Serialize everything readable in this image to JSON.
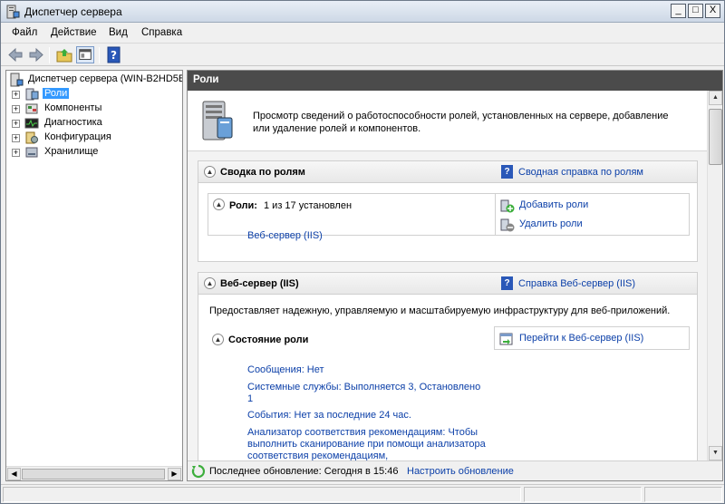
{
  "window": {
    "title": "Диспетчер сервера",
    "buttons": {
      "minimize": "_",
      "maximize": "□",
      "close": "X"
    }
  },
  "menu": [
    "Файл",
    "Действие",
    "Вид",
    "Справка"
  ],
  "toolbar": {
    "icons": [
      "back-arrow-icon",
      "forward-arrow-icon",
      "up-folder-icon",
      "show-hide-console-tree-icon",
      "help-icon"
    ]
  },
  "tree": {
    "root": "Диспетчер сервера (WIN-B2HD5B",
    "items": [
      {
        "label": "Роли",
        "icon": "roles-icon",
        "selected": true
      },
      {
        "label": "Компоненты",
        "icon": "features-icon",
        "selected": false
      },
      {
        "label": "Диагностика",
        "icon": "diagnostics-icon",
        "selected": false
      },
      {
        "label": "Конфигурация",
        "icon": "configuration-icon",
        "selected": false
      },
      {
        "label": "Хранилище",
        "icon": "storage-icon",
        "selected": false
      }
    ]
  },
  "main": {
    "header": "Роли",
    "intro": "Просмотр сведений о работоспособности ролей, установленных на сервере, добавление или удаление ролей и компонентов.",
    "summary": {
      "title": "Сводка по ролям",
      "help_link": "Сводная справка по ролям",
      "roles_label": "Роли:",
      "roles_count": "1 из 17 установлен",
      "role_link": "Веб-сервер (IIS)",
      "add_roles": "Добавить роли",
      "remove_roles": "Удалить роли"
    },
    "webserver": {
      "title": "Веб-сервер (IIS)",
      "help_link": "Справка Веб-сервер (IIS)",
      "description": "Предоставляет надежную, управляемую и масштабируемую инфраструктуру для веб-приложений.",
      "status_title": "Состояние роли",
      "goto_link": "Перейти к Веб-сервер (IIS)",
      "messages": "Сообщения: Нет",
      "services": "Системные службы: Выполняется 3, Остановлено 1",
      "events": "События: Нет за последние 24 час.",
      "bpa": "Анализатор соответствия рекомендациям: Чтобы выполнить сканирование при помощи анализатора соответствия рекомендациям,"
    },
    "footer": {
      "last_update": "Последнее обновление: Сегодня в 15:46",
      "configure_link": "Настроить обновление"
    }
  },
  "colors": {
    "header_bg": "#4b4b4b",
    "link": "#0b3fa8",
    "selection": "#3399ff"
  }
}
